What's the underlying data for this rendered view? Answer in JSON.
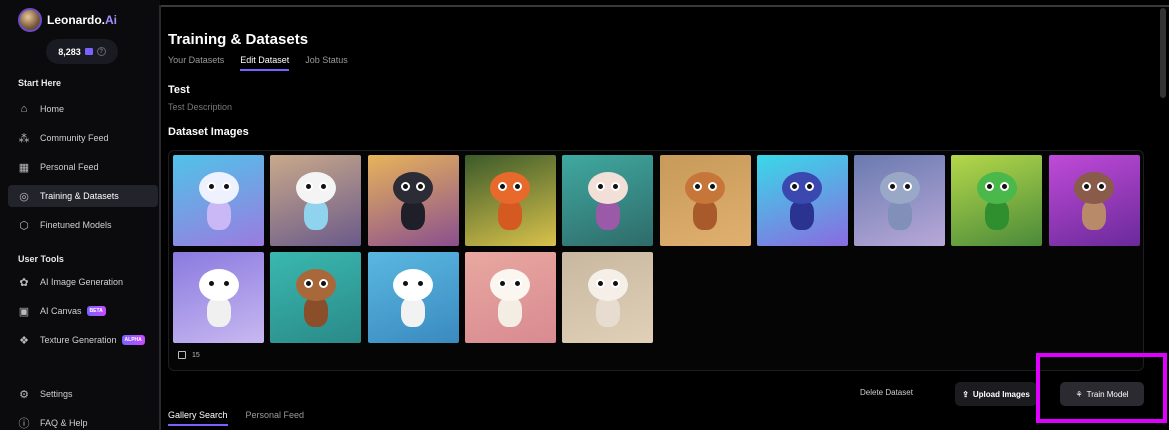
{
  "app": {
    "name_main": "Leonardo.",
    "name_accent": "Ai"
  },
  "credits": {
    "amount": "8,283"
  },
  "sidebar": {
    "start_here": "Start Here",
    "items": [
      {
        "label": "Home",
        "icon": "home-icon",
        "glyph": "⌂"
      },
      {
        "label": "Community Feed",
        "icon": "community-icon",
        "glyph": "⁂"
      },
      {
        "label": "Personal Feed",
        "icon": "grid-icon",
        "glyph": "▦"
      },
      {
        "label": "Training & Datasets",
        "icon": "training-icon",
        "glyph": "◎",
        "active": true
      },
      {
        "label": "Finetuned Models",
        "icon": "cube-icon",
        "glyph": "⬡"
      }
    ],
    "user_tools": "User Tools",
    "tools": [
      {
        "label": "AI Image Generation",
        "icon": "palette-icon",
        "glyph": "✿"
      },
      {
        "label": "AI Canvas",
        "icon": "canvas-icon",
        "glyph": "▣",
        "badge": "BETA"
      },
      {
        "label": "Texture Generation",
        "icon": "texture-icon",
        "glyph": "❖",
        "badge": "ALPHA"
      }
    ],
    "settings": "Settings",
    "faq": "FAQ & Help"
  },
  "main": {
    "title": "Training & Datasets",
    "tabs": [
      {
        "label": "Your Datasets"
      },
      {
        "label": "Edit Dataset",
        "active": true
      },
      {
        "label": "Job Status"
      }
    ],
    "dataset_name": "Test",
    "dataset_description": "Test Description",
    "dataset_images_label": "Dataset Images",
    "image_count": "15",
    "thumbnails": [
      {
        "bg": "linear-gradient(160deg,#4fc3e8,#9b7be0)",
        "head": "#eef2ff",
        "body": "#c9b8f5"
      },
      {
        "bg": "linear-gradient(160deg,#c9a98a,#6a5a8a)",
        "head": "#f4f4f4",
        "body": "#8fd3ee"
      },
      {
        "bg": "linear-gradient(160deg,#e7b45a,#8a4f8f)",
        "head": "#2c2c36",
        "body": "#1f1f2a"
      },
      {
        "bg": "linear-gradient(160deg,#3b5a2a,#d9c24b)",
        "head": "#e76a2c",
        "body": "#d45a22"
      },
      {
        "bg": "linear-gradient(160deg,#3fa9a0,#2f6b6a)",
        "head": "#f2e0d8",
        "body": "#9a5aa8"
      },
      {
        "bg": "linear-gradient(160deg,#c79a5a,#e0b070)",
        "head": "#c7763a",
        "body": "#a85a2a"
      },
      {
        "bg": "linear-gradient(160deg,#38d9e8,#8a6be0)",
        "head": "#3b48b0",
        "body": "#2a3390"
      },
      {
        "bg": "linear-gradient(160deg,#6a7ab0,#b8a8d8)",
        "head": "#9aa8c8",
        "body": "#8090b8"
      },
      {
        "bg": "linear-gradient(160deg,#b5d84a,#4a8a3a)",
        "head": "#4ab84a",
        "body": "#2f8f2f"
      },
      {
        "bg": "linear-gradient(160deg,#c04ad8,#6a2a9a)",
        "head": "#8a5a4a",
        "body": "#b88a6a"
      },
      {
        "bg": "linear-gradient(160deg,#8a7ae0,#c8b8f0)",
        "head": "#ffffff",
        "body": "#f0f0f0"
      },
      {
        "bg": "linear-gradient(160deg,#3ab8b0,#2a8a88)",
        "head": "#a8683a",
        "body": "#8a4f2a"
      },
      {
        "bg": "linear-gradient(160deg,#5ab8e0,#3a8ac0)",
        "head": "#ffffff",
        "body": "#f2f2f2"
      },
      {
        "bg": "linear-gradient(160deg,#e8a8a0,#d88a90)",
        "head": "#fbf6f0",
        "body": "#f4ede4"
      },
      {
        "bg": "linear-gradient(160deg,#c8b8a0,#e0d0b8)",
        "head": "#f5efe8",
        "body": "#e8dcd0"
      }
    ]
  },
  "actions": {
    "delete": "Delete Dataset",
    "upload": "Upload Images",
    "train": "Train Model"
  },
  "bottom_tabs": [
    {
      "label": "Gallery Search",
      "active": true
    },
    {
      "label": "Personal Feed"
    }
  ],
  "colors": {
    "accent": "#7b61ff",
    "highlight": "#e000ff"
  }
}
